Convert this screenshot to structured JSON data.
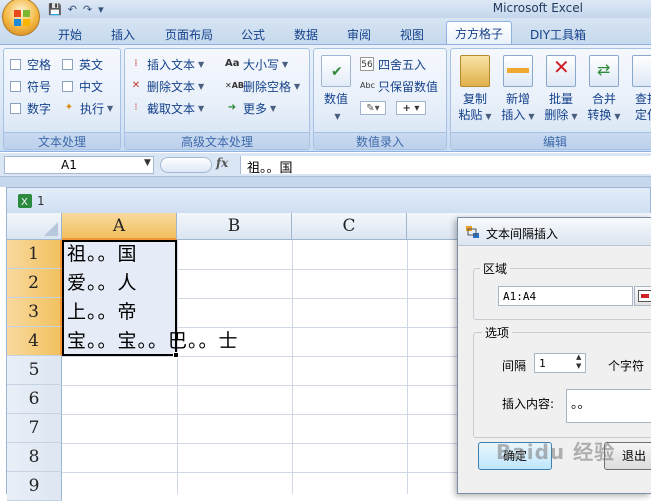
{
  "window": {
    "title": "Microsoft Excel"
  },
  "tabs": [
    {
      "label": "开始"
    },
    {
      "label": "插入"
    },
    {
      "label": "页面布局"
    },
    {
      "label": "公式"
    },
    {
      "label": "数据"
    },
    {
      "label": "审阅"
    },
    {
      "label": "视图"
    },
    {
      "label": "方方格子",
      "active": true
    },
    {
      "label": "DIY工具箱"
    }
  ],
  "ribbon": {
    "text_group": {
      "label": "文本处理",
      "checks": [
        "空格",
        "英文",
        "符号",
        "中文",
        "数字"
      ],
      "execute": "执行"
    },
    "advanced_group": {
      "label": "高级文本处理",
      "insert_text": "插入文本",
      "delete_text": "删除文本",
      "extract_text": "截取文本",
      "case": "大小写",
      "delete_spaces": "删除空格",
      "more": "更多"
    },
    "entry_group": {
      "label": "数值录入",
      "value": "数值",
      "round": "四舍五入",
      "keep_values": "只保留数值"
    },
    "edit_group": {
      "label": "编辑",
      "buttons": [
        {
          "line1": "复制",
          "line2": "粘贴"
        },
        {
          "line1": "新增",
          "line2": "插入"
        },
        {
          "line1": "批量",
          "line2": "删除"
        },
        {
          "line1": "合并",
          "line2": "转换"
        },
        {
          "line1": "查找",
          "line2": "定位"
        }
      ]
    }
  },
  "formula_bar": {
    "name_box": "A1",
    "fx": "fx",
    "value": "祖。。国"
  },
  "workbook": {
    "title": "1"
  },
  "sheet": {
    "columns": [
      "A",
      "B",
      "C"
    ],
    "rows": [
      "1",
      "2",
      "3",
      "4",
      "5",
      "6",
      "7",
      "8",
      "9"
    ],
    "cells": [
      "祖。。国",
      "爱。。人",
      "上。。帝",
      "宝。。宝。。巴。。士"
    ]
  },
  "dialog": {
    "title": "文本间隔插入",
    "range_legend": "区域",
    "range_value": "A1:A4",
    "options_legend": "选项",
    "interval_label": "间隔",
    "interval_value": "1",
    "interval_unit": "个字符",
    "insert_label": "插入内容:",
    "insert_value": "。。",
    "ok": "确定",
    "cancel": "退出"
  },
  "watermark": "Baidu 经验",
  "colors": {
    "accent": "#f29536",
    "ribbon_text": "#15428b",
    "selection": "#e6ecf7"
  }
}
